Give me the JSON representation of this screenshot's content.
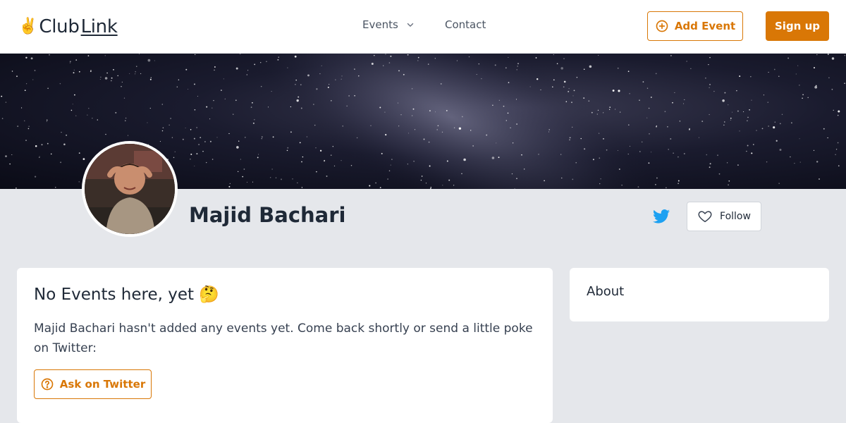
{
  "header": {
    "logo": {
      "emoji": "✌️",
      "club": "Club",
      "link": "Link"
    },
    "nav": {
      "events_label": "Events",
      "contact_label": "Contact"
    },
    "add_event_label": "Add Event",
    "signup_label": "Sign up"
  },
  "profile": {
    "name": "Majid Bachari",
    "follow_label": "Follow",
    "twitter_icon": "twitter-icon"
  },
  "main": {
    "title": "No Events here, yet 🤔",
    "message": "Majid Bachari hasn't added any events yet. Come back shortly or send a little poke on Twitter:",
    "ask_label": "Ask on Twitter"
  },
  "sidebar": {
    "about_title": "About"
  },
  "colors": {
    "accent": "#d97706",
    "twitter": "#1da1f2",
    "page_bg": "#e5e7eb"
  }
}
